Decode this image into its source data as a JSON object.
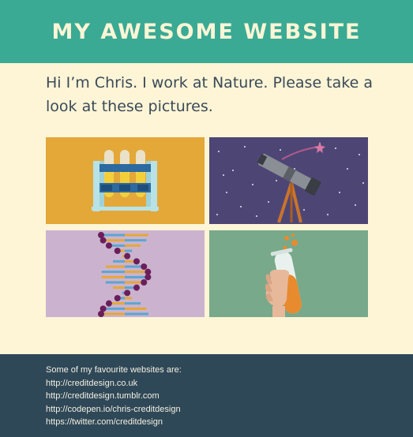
{
  "header": {
    "title": "MY AWESOME WEBSITE"
  },
  "intro": {
    "text": "Hi I’m Chris. I work at Nature. Please take a look at these pictures."
  },
  "gallery": {
    "tiles": [
      {
        "icon": "test-tube-rack-icon",
        "bg": "#e4a838"
      },
      {
        "icon": "telescope-icon",
        "bg": "#4d4675"
      },
      {
        "icon": "dna-helix-icon",
        "bg": "#cbb3d0"
      },
      {
        "icon": "hand-holding-test-tube-icon",
        "bg": "#77a98a"
      }
    ]
  },
  "footer": {
    "intro": "Some of my favourite websites are:",
    "links": [
      "http://creditdesign.co.uk",
      "http://creditdesign.tumblr.com",
      "http://codepen.io/chris-creditdesign",
      "https://twitter.com/creditdesign"
    ]
  },
  "colors": {
    "header_bg": "#3aaa94",
    "page_bg": "#fdf5d6",
    "footer_bg": "#2f4858",
    "text": "#3a4a58"
  }
}
